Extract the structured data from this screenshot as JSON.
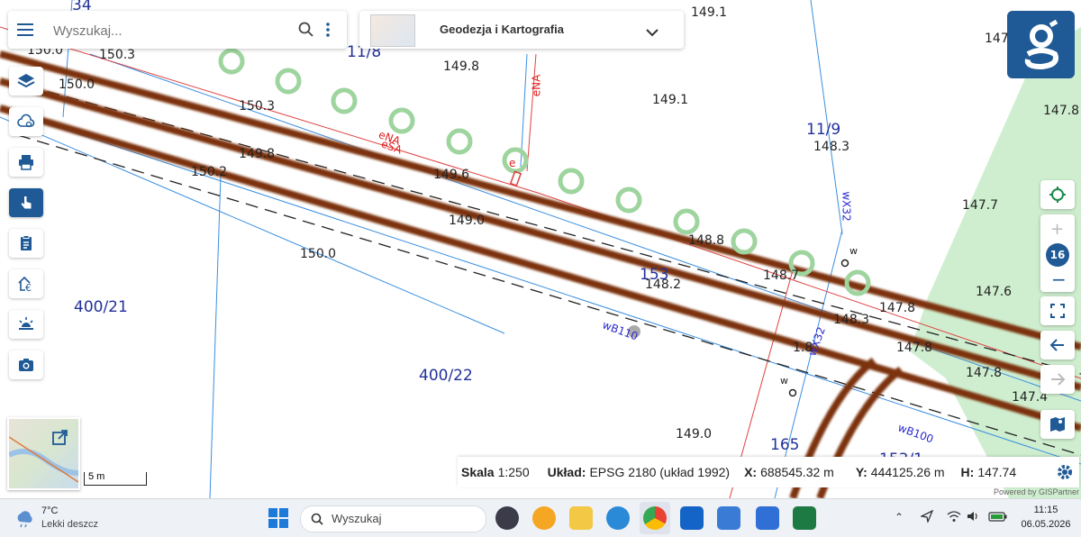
{
  "search": {
    "placeholder": "Wyszukaj..."
  },
  "layer_selector": {
    "label": "Geodezja i Kartografia"
  },
  "zoom_level": "16",
  "scale_bar": {
    "label": "5 m"
  },
  "status": {
    "scale_label": "Skala",
    "scale_value": "1:250",
    "crs_label": "Układ:",
    "crs_value": "EPSG 2180 (układ 1992)",
    "x_label": "X:",
    "x_value": "688545.32 m",
    "y_label": "Y:",
    "y_value": "444125.26 m",
    "h_label": "H:",
    "h_value": "147.74"
  },
  "powered_by": "Powered by GISPartner",
  "map_labels": {
    "heights": [
      "149.1",
      "149.8",
      "150.3",
      "150.0",
      "150.3",
      "149.8",
      "150.2",
      "149.6",
      "149.0",
      "149.1",
      "148.3",
      "148.8",
      "148.7",
      "148.2",
      "148.3",
      "147.8",
      "147.8",
      "147.8",
      "147.4",
      "147.6",
      "147.7",
      "147.8",
      "149.0",
      "150.0",
      "150.0",
      "147"
    ],
    "parcels": [
      "34",
      "11/8",
      "11/9",
      "153",
      "400/21",
      "400/22",
      "165",
      "153/1"
    ],
    "utilities": [
      "eNA",
      "eSA",
      "e",
      "wX32",
      "wX32",
      "wB110",
      "wB100",
      "w",
      "w"
    ]
  },
  "taskbar": {
    "weather_temp": "7°C",
    "weather_desc": "Lekki deszcz",
    "search_placeholder": "Wyszukaj",
    "time": "11:15",
    "date": "06.05.2026"
  },
  "icons": [
    "menu-icon",
    "search-icon",
    "more-vert-icon",
    "chevron-down-icon",
    "layers-icon",
    "cloud-icon",
    "print-icon",
    "touch-icon",
    "clipboard-icon",
    "house-euro-icon",
    "sunrise-icon",
    "camera-icon",
    "target-icon",
    "plus-icon",
    "minus-icon",
    "fullscreen-icon",
    "arrow-left-icon",
    "arrow-right-icon",
    "street-view-icon",
    "settings-icon",
    "expand-icon",
    "logo-g-icon"
  ],
  "colors": {
    "accent": "#1f5a96",
    "road": "#7b3008",
    "vegetation": "#cdefcf",
    "parcel_line": "#2f8fe0"
  }
}
